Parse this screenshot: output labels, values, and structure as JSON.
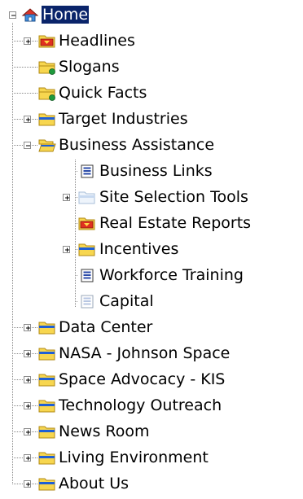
{
  "tree": {
    "root": {
      "label": "Home",
      "icon": "home-icon",
      "expander": "minus",
      "selected": true
    },
    "items": [
      {
        "level": 1,
        "label": "Headlines",
        "icon": "folder-red-icon",
        "expander": "plus"
      },
      {
        "level": 1,
        "label": "Slogans",
        "icon": "folder-green-dot-icon",
        "expander": "none"
      },
      {
        "level": 1,
        "label": "Quick Facts",
        "icon": "folder-green-dot-icon",
        "expander": "none"
      },
      {
        "level": 1,
        "label": "Target Industries",
        "icon": "folder-blue-icon",
        "expander": "plus"
      },
      {
        "level": 1,
        "label": "Business Assistance",
        "icon": "folder-open-icon",
        "expander": "minus"
      },
      {
        "level": 2,
        "label": "Business Links",
        "icon": "document-icon",
        "expander": "none"
      },
      {
        "level": 2,
        "label": "Site Selection Tools",
        "icon": "folder-faded-icon",
        "expander": "plus"
      },
      {
        "level": 2,
        "label": "Real Estate Reports",
        "icon": "folder-red-icon",
        "expander": "none"
      },
      {
        "level": 2,
        "label": "Incentives",
        "icon": "folder-blue-icon",
        "expander": "plus"
      },
      {
        "level": 2,
        "label": "Workforce Training",
        "icon": "document-icon",
        "expander": "none"
      },
      {
        "level": 2,
        "label": "Capital",
        "icon": "document-faded-icon",
        "expander": "none"
      },
      {
        "level": 1,
        "label": "Data Center",
        "icon": "folder-blue-icon",
        "expander": "plus"
      },
      {
        "level": 1,
        "label": "NASA - Johnson Space",
        "icon": "folder-blue-icon",
        "expander": "plus"
      },
      {
        "level": 1,
        "label": "Space Advocacy - KIS",
        "icon": "folder-blue-icon",
        "expander": "plus"
      },
      {
        "level": 1,
        "label": "Technology Outreach",
        "icon": "folder-blue-icon",
        "expander": "plus"
      },
      {
        "level": 1,
        "label": "News Room",
        "icon": "folder-blue-icon",
        "expander": "plus"
      },
      {
        "level": 1,
        "label": "Living Environment",
        "icon": "folder-blue-icon",
        "expander": "plus"
      },
      {
        "level": 1,
        "label": "About Us",
        "icon": "folder-blue-icon",
        "expander": "plus"
      }
    ]
  },
  "colors": {
    "selection_bg": "#0a246a",
    "selection_text": "#ffffff",
    "folder_yellow": "#f7d64f",
    "folder_border": "#b08a16",
    "folder_blue_band": "#1f5fd6",
    "red_badge": "#e03020",
    "green_badge": "#1e9a3c",
    "document_blue": "#2a4aa8"
  }
}
